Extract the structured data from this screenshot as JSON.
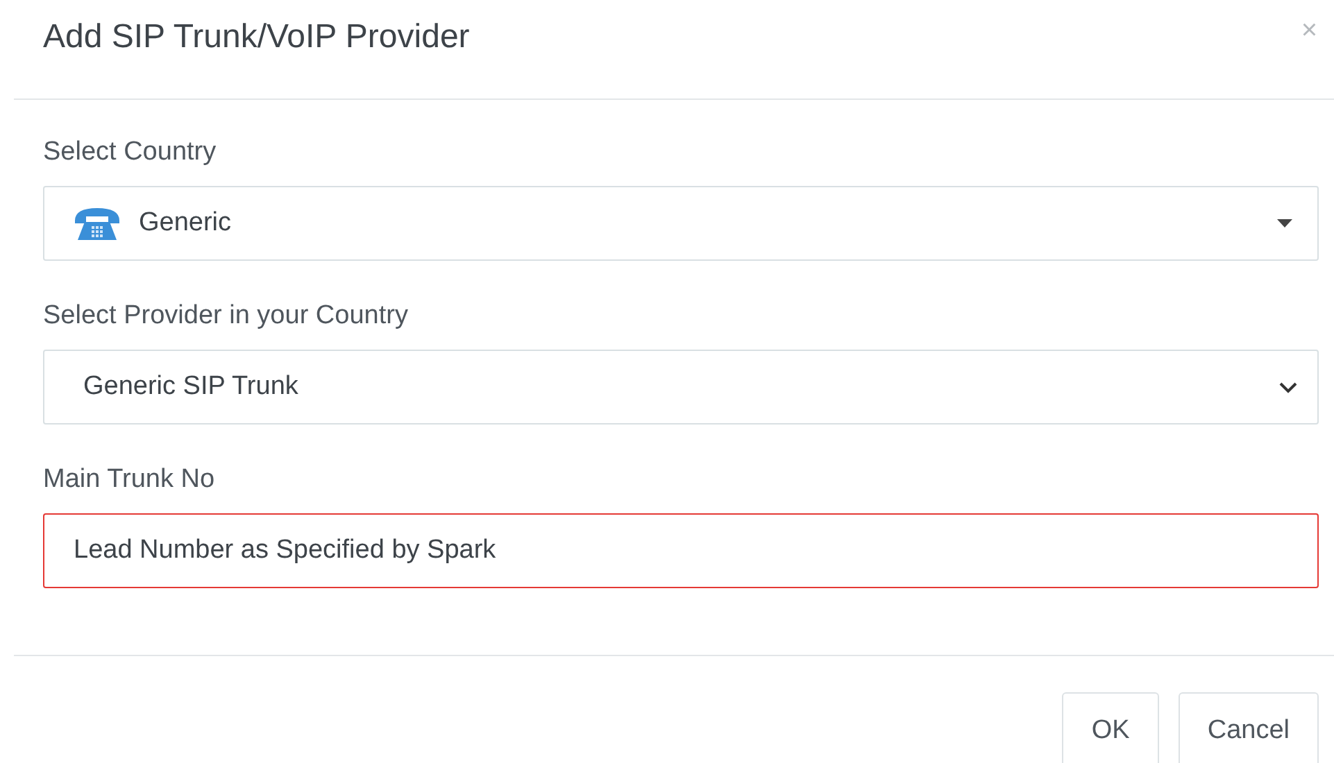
{
  "dialog": {
    "title": "Add SIP Trunk/VoIP Provider",
    "close": "×"
  },
  "fields": [
    {
      "kind": "icon-select",
      "label": "Select Country",
      "value": "Generic",
      "invalid": false
    },
    {
      "kind": "select",
      "label": "Select Provider in your Country",
      "value": "Generic SIP Trunk",
      "invalid": false
    },
    {
      "kind": "text",
      "label": "Main Trunk No",
      "value": "Lead Number as Specified by Spark",
      "invalid": true
    }
  ],
  "buttons": [
    "OK",
    "Cancel"
  ]
}
